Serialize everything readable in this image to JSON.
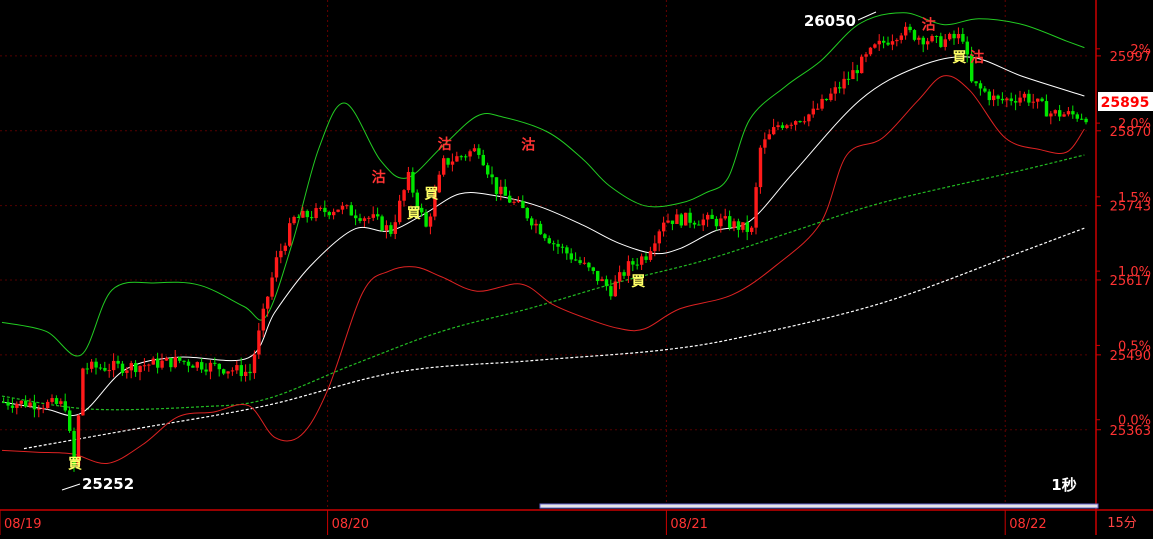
{
  "chart_data": {
    "type": "candlestick",
    "interval_label": "15分",
    "timeframe_label": "1秒",
    "dates": [
      "08/19",
      "08/20",
      "08/21",
      "08/22"
    ],
    "ylim": [
      25232,
      26085
    ],
    "price_ticks": [
      25363,
      25490,
      25617,
      25743,
      25870,
      25997
    ],
    "percent_ticks": [
      "0.0%",
      "0.5%",
      "1.0%",
      "1.5%",
      "2.0%",
      "2%"
    ],
    "percent_tick_values": [
      25380,
      25506,
      25632,
      25758,
      25883,
      26009
    ],
    "last_price": 25895,
    "high_label": "26050",
    "low_label": "25252",
    "high_value": 26050,
    "low_value": 25252,
    "signal_labels": [
      {
        "text": "買",
        "bar": 15,
        "price": 25297
      },
      {
        "text": "沽",
        "bar": 84,
        "price": 25783
      },
      {
        "text": "買",
        "bar": 92,
        "price": 25722
      },
      {
        "text": "買",
        "bar": 96,
        "price": 25755
      },
      {
        "text": "沽",
        "bar": 99,
        "price": 25839
      },
      {
        "text": "沽",
        "bar": 118,
        "price": 25838
      },
      {
        "text": "買",
        "bar": 143,
        "price": 25607
      },
      {
        "text": "沽",
        "bar": 209,
        "price": 26042
      },
      {
        "text": "買",
        "bar": 216,
        "price": 25987
      },
      {
        "text": "沽",
        "bar": 220,
        "price": 25987
      }
    ],
    "colors": {
      "up": "#ff1a1a",
      "down": "#00e600",
      "upper_band": "#22cc22",
      "lower_band": "#dd2222",
      "middle_band": "#ffffff",
      "ma_long": "#22bb22",
      "ma_longer": "#ffffff",
      "axis": "#cc0000",
      "label": "#ff3333",
      "signal_buy": "#ffff66",
      "signal_sell": "#ff3333"
    },
    "bb_upper": [
      [
        0,
        25545
      ],
      [
        10,
        25530
      ],
      [
        18,
        25490
      ],
      [
        25,
        25600
      ],
      [
        35,
        25612
      ],
      [
        45,
        25608
      ],
      [
        55,
        25572
      ],
      [
        60,
        25555
      ],
      [
        66,
        25680
      ],
      [
        72,
        25840
      ],
      [
        78,
        25917
      ],
      [
        86,
        25820
      ],
      [
        92,
        25790
      ],
      [
        100,
        25843
      ],
      [
        108,
        25895
      ],
      [
        114,
        25893
      ],
      [
        124,
        25868
      ],
      [
        132,
        25822
      ],
      [
        138,
        25777
      ],
      [
        146,
        25743
      ],
      [
        154,
        25747
      ],
      [
        160,
        25765
      ],
      [
        165,
        25790
      ],
      [
        170,
        25890
      ],
      [
        178,
        25945
      ],
      [
        186,
        25988
      ],
      [
        195,
        26052
      ],
      [
        205,
        26070
      ],
      [
        214,
        26050
      ],
      [
        222,
        26060
      ],
      [
        232,
        26050
      ],
      [
        242,
        26022
      ],
      [
        246,
        26011
      ]
    ],
    "bb_middle": [
      [
        0,
        25410
      ],
      [
        10,
        25398
      ],
      [
        18,
        25391
      ],
      [
        28,
        25465
      ],
      [
        40,
        25486
      ],
      [
        56,
        25485
      ],
      [
        62,
        25562
      ],
      [
        70,
        25640
      ],
      [
        80,
        25703
      ],
      [
        88,
        25700
      ],
      [
        96,
        25729
      ],
      [
        104,
        25763
      ],
      [
        112,
        25760
      ],
      [
        122,
        25742
      ],
      [
        132,
        25710
      ],
      [
        140,
        25680
      ],
      [
        148,
        25662
      ],
      [
        154,
        25670
      ],
      [
        162,
        25700
      ],
      [
        170,
        25717
      ],
      [
        180,
        25800
      ],
      [
        195,
        25922
      ],
      [
        208,
        25978
      ],
      [
        220,
        25995
      ],
      [
        232,
        25962
      ],
      [
        246,
        25929
      ]
    ],
    "bb_lower": [
      [
        0,
        25328
      ],
      [
        8,
        25325
      ],
      [
        16,
        25322
      ],
      [
        24,
        25306
      ],
      [
        32,
        25338
      ],
      [
        40,
        25385
      ],
      [
        48,
        25393
      ],
      [
        56,
        25404
      ],
      [
        62,
        25350
      ],
      [
        68,
        25354
      ],
      [
        74,
        25430
      ],
      [
        82,
        25596
      ],
      [
        88,
        25632
      ],
      [
        94,
        25639
      ],
      [
        100,
        25622
      ],
      [
        108,
        25598
      ],
      [
        118,
        25610
      ],
      [
        125,
        25576
      ],
      [
        132,
        25554
      ],
      [
        140,
        25535
      ],
      [
        146,
        25534
      ],
      [
        154,
        25568
      ],
      [
        166,
        25592
      ],
      [
        176,
        25642
      ],
      [
        186,
        25713
      ],
      [
        192,
        25829
      ],
      [
        200,
        25857
      ],
      [
        208,
        25920
      ],
      [
        214,
        25963
      ],
      [
        220,
        25938
      ],
      [
        228,
        25858
      ],
      [
        236,
        25838
      ],
      [
        242,
        25834
      ],
      [
        246,
        25873
      ]
    ],
    "ma_long": [
      [
        0,
        25420
      ],
      [
        20,
        25398
      ],
      [
        45,
        25402
      ],
      [
        60,
        25415
      ],
      [
        80,
        25474
      ],
      [
        100,
        25530
      ],
      [
        120,
        25569
      ],
      [
        140,
        25613
      ],
      [
        160,
        25651
      ],
      [
        180,
        25700
      ],
      [
        200,
        25748
      ],
      [
        230,
        25800
      ],
      [
        246,
        25829
      ]
    ],
    "ma_longer": [
      [
        5,
        25331
      ],
      [
        30,
        25364
      ],
      [
        60,
        25404
      ],
      [
        90,
        25461
      ],
      [
        120,
        25480
      ],
      [
        150,
        25498
      ],
      [
        170,
        25523
      ],
      [
        200,
        25578
      ],
      [
        230,
        25660
      ],
      [
        246,
        25705
      ]
    ]
  }
}
